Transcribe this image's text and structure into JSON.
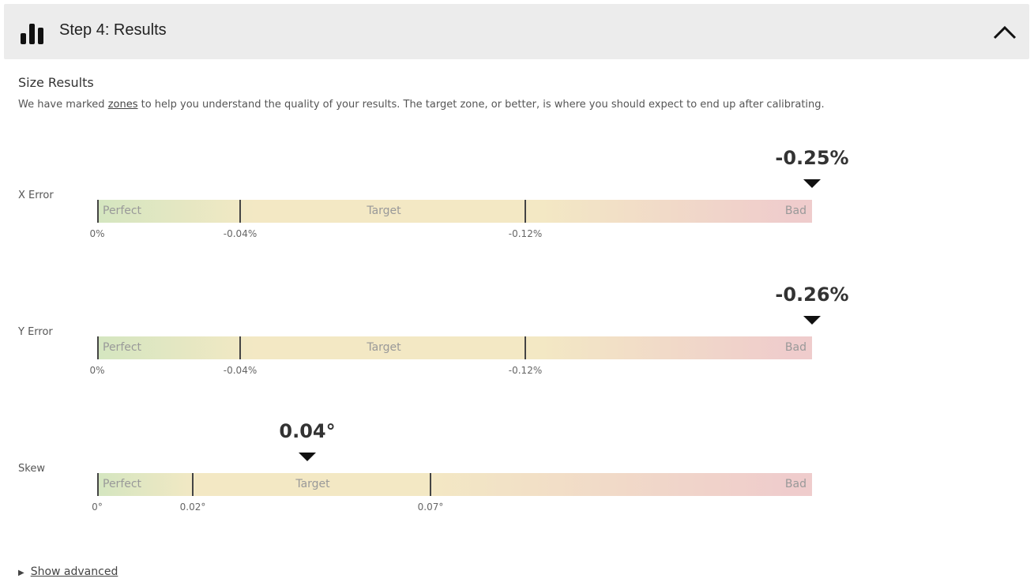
{
  "header": {
    "title": "Step 4: Results",
    "icon": "bar-chart-icon",
    "collapse_icon": "chevron-up-icon"
  },
  "section": {
    "title": "Size Results",
    "desc_before": "We have marked ",
    "desc_link": "zones",
    "desc_after": " to help you understand the quality of your results. The target zone, or better, is where you should expect to end up after calibrating."
  },
  "rows": [
    {
      "label": "X Error",
      "value_text": "-0.25%",
      "zones": [
        "Perfect",
        "Target",
        "Bad"
      ],
      "ticks": [
        "0%",
        "-0.04%",
        "-0.12%"
      ]
    },
    {
      "label": "Y Error",
      "value_text": "-0.26%",
      "zones": [
        "Perfect",
        "Target",
        "Bad"
      ],
      "ticks": [
        "0%",
        "-0.04%",
        "-0.12%"
      ]
    },
    {
      "label": "Skew",
      "value_text": "0.04°",
      "zones": [
        "Perfect",
        "Target",
        "Bad"
      ],
      "ticks": [
        "0°",
        "0.02°",
        "0.07°"
      ]
    }
  ],
  "colors": {
    "perfect": "#d4e6c0",
    "target": "#f3e8c4",
    "bad": "#efcccc",
    "header_bg": "#ececec",
    "marker": "#111111"
  },
  "advanced": {
    "label": "Show advanced",
    "icon": "triangle-right-icon"
  }
}
